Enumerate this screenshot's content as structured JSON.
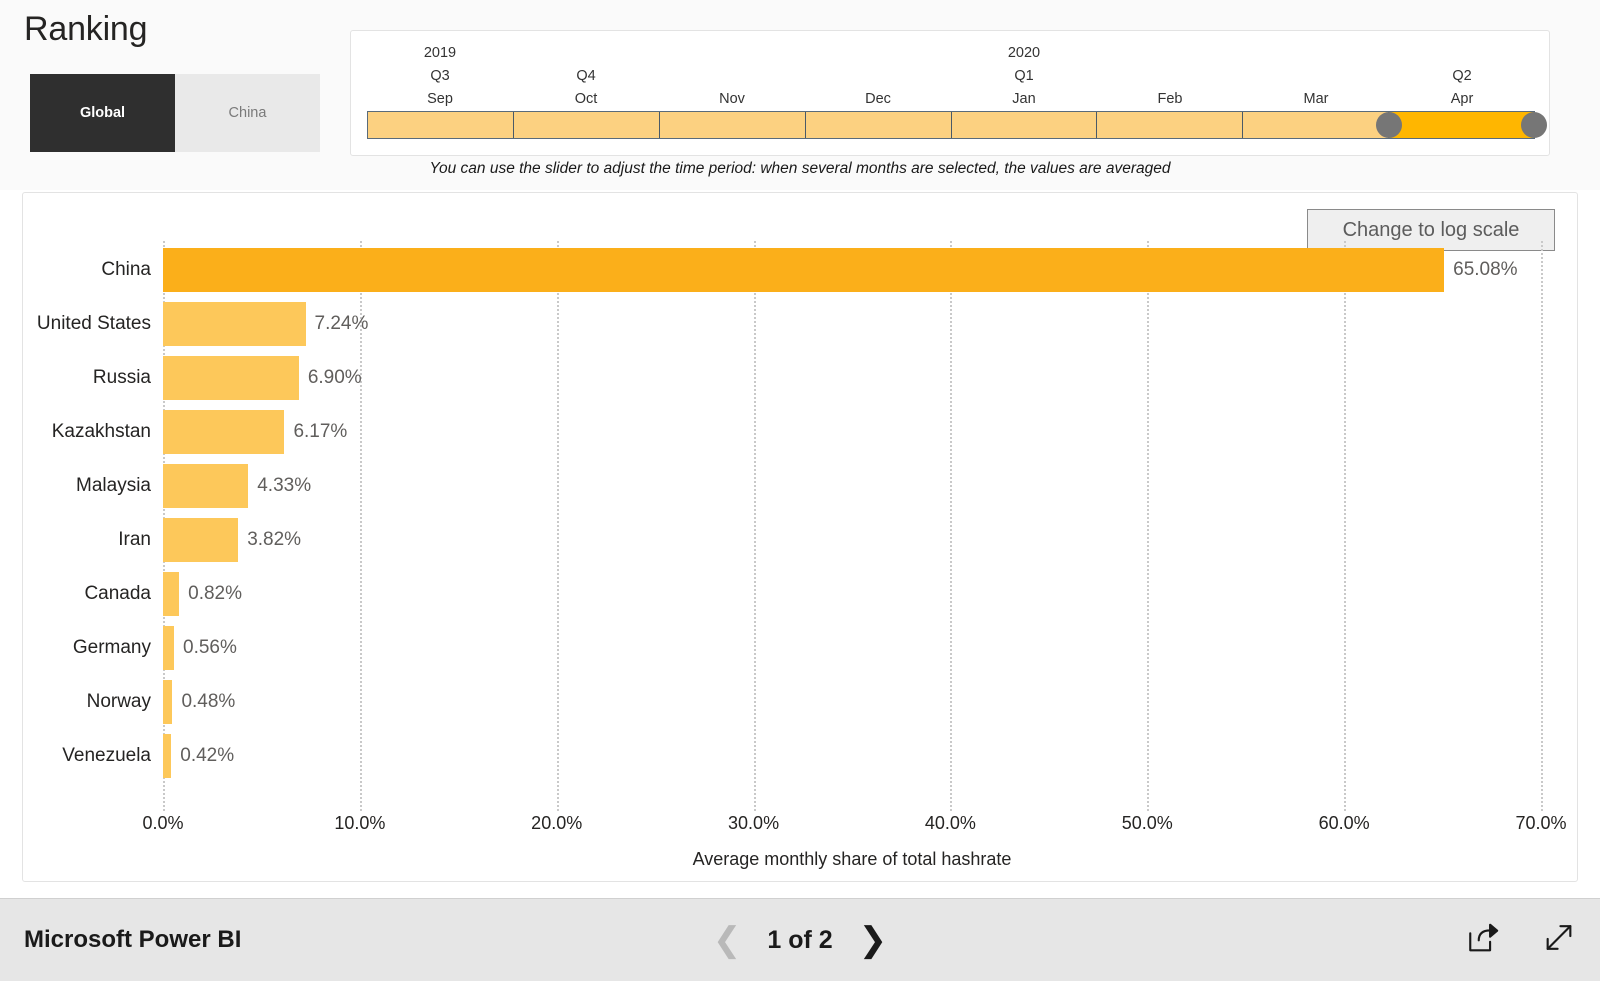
{
  "header": {
    "title": "Ranking",
    "toggle": {
      "options": [
        {
          "label": "Global",
          "active": true
        },
        {
          "label": "China",
          "active": false
        }
      ]
    }
  },
  "timeline": {
    "note": "You can use the slider to adjust the time period: when several months are selected, the values are averaged",
    "segments": [
      {
        "year": "2019",
        "quarter": "Q3",
        "month": "Sep",
        "selected": false
      },
      {
        "year": "",
        "quarter": "Q4",
        "month": "Oct",
        "selected": false
      },
      {
        "year": "",
        "quarter": "",
        "month": "Nov",
        "selected": false
      },
      {
        "year": "",
        "quarter": "",
        "month": "Dec",
        "selected": false
      },
      {
        "year": "2020",
        "quarter": "Q1",
        "month": "Jan",
        "selected": false
      },
      {
        "year": "",
        "quarter": "",
        "month": "Feb",
        "selected": false
      },
      {
        "year": "",
        "quarter": "",
        "month": "Mar",
        "selected": false
      },
      {
        "year": "",
        "quarter": "Q2",
        "month": "Apr",
        "selected": true
      }
    ],
    "selected_range": {
      "start": "Apr",
      "end": "Apr"
    },
    "colors": {
      "segment": "#fcd181",
      "selected": "#ffb600",
      "handle": "#767676"
    }
  },
  "chart_panel": {
    "log_scale_button": "Change to log scale"
  },
  "chart_data": {
    "type": "bar",
    "orientation": "horizontal",
    "title": "",
    "xlabel": "Average monthly share of total hashrate",
    "ylabel": "",
    "xlim": [
      0,
      70
    ],
    "xticks": [
      "0.0%",
      "10.0%",
      "20.0%",
      "30.0%",
      "40.0%",
      "50.0%",
      "60.0%",
      "70.0%"
    ],
    "xtick_values": [
      0,
      10,
      20,
      30,
      40,
      50,
      60,
      70
    ],
    "grid": true,
    "legend": "none",
    "categories": [
      "China",
      "United States",
      "Russia",
      "Kazakhstan",
      "Malaysia",
      "Iran",
      "Canada",
      "Germany",
      "Norway",
      "Venezuela"
    ],
    "values": [
      65.08,
      7.24,
      6.9,
      6.17,
      4.33,
      3.82,
      0.82,
      0.56,
      0.48,
      0.42
    ],
    "labels": [
      "65.08%",
      "7.24%",
      "6.90%",
      "6.17%",
      "4.33%",
      "3.82%",
      "0.82%",
      "0.56%",
      "0.48%",
      "0.42%"
    ],
    "colors": {
      "bar": "#fdc85a",
      "highlight": "#fbaf1a"
    },
    "highlight_index": 0
  },
  "footer": {
    "brand": "Microsoft Power BI",
    "pager": {
      "prev_icon": "chevron-left-icon",
      "next_icon": "chevron-right-icon",
      "text": "1 of 2",
      "prev_enabled": false,
      "next_enabled": true
    },
    "icons": [
      {
        "name": "share-icon"
      },
      {
        "name": "fullscreen-icon"
      }
    ]
  }
}
